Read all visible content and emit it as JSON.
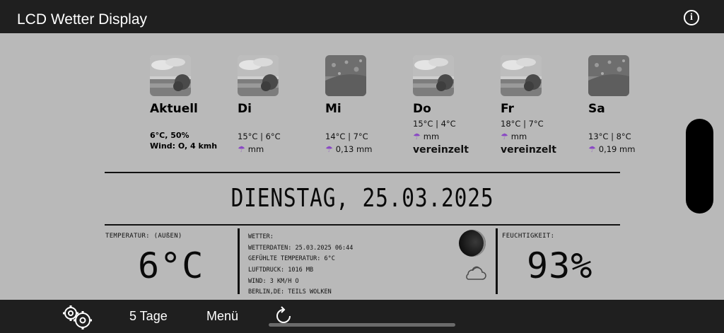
{
  "header": {
    "title": "LCD Wetter Display",
    "info_icon": "info-icon",
    "info_glyph": "i"
  },
  "forecast": [
    {
      "day": "Aktuell",
      "lines": [
        "6°C, 50%",
        "Wind: O, 4 kmh"
      ],
      "image": "cloudy-landscape"
    },
    {
      "day": "Di",
      "temp": "15°C | 6°C",
      "rain": "mm",
      "cond": "",
      "image": "cloudy-landscape"
    },
    {
      "day": "Mi",
      "temp": "14°C | 7°C",
      "rain": "0,13 mm",
      "cond": "",
      "image": "rain-drops"
    },
    {
      "day": "Do",
      "temp": "15°C | 4°C",
      "rain": "mm",
      "cond": "vereinzelt",
      "image": "cloudy-landscape"
    },
    {
      "day": "Fr",
      "temp": "18°C | 7°C",
      "rain": "mm",
      "cond": "vereinzelt",
      "image": "cloudy-landscape"
    },
    {
      "day": "Sa",
      "temp": "13°C | 8°C",
      "rain": "0,19 mm",
      "cond": "",
      "image": "rain-drops"
    }
  ],
  "date_display": "DIENSTAG, 25.03.2025",
  "temperature": {
    "label": "TEMPERATUR: (AUßEN)",
    "value": "6°C"
  },
  "weather": {
    "lines": [
      "WETTER:",
      "WETTERDATEN: 25.03.2025 06:44",
      "GEFÜHLTE TEMPERATUR: 6°C",
      "LUFTDRUCK: 1016 MB",
      "WIND: 3 KM/H O",
      "BERLIN,DE: TEILS WOLKEN"
    ],
    "moon_icon": "moon-icon",
    "cloud_icon": "cloud-icon"
  },
  "humidity": {
    "label": "FEUCHTIGKEIT:",
    "value": "93%"
  },
  "footer": {
    "tab_5days": "5 Tage",
    "menu": "Menü",
    "settings_icon": "gears-icon",
    "refresh_icon": "refresh-icon"
  },
  "colors": {
    "background": "#b9b9b9",
    "bars": "#1f1f1f",
    "umbrella": "#8a49c4"
  }
}
